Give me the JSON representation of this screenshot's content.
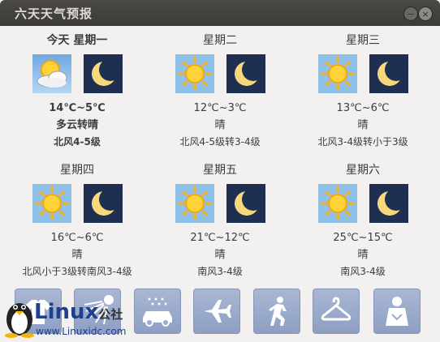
{
  "window": {
    "title": "六天天气预报",
    "minimize_glyph": "−",
    "close_glyph": "×"
  },
  "days": [
    {
      "name": "今天  星期一",
      "temp": "14℃~5℃",
      "condition": "多云转晴",
      "wind": "北风4-5级",
      "day_icon": "partly-cloudy-icon",
      "night_icon": "moon-icon"
    },
    {
      "name": "星期二",
      "temp": "12℃~3℃",
      "condition": "晴",
      "wind": "北风4-5级转3-4级",
      "day_icon": "sun-icon",
      "night_icon": "moon-icon"
    },
    {
      "name": "星期三",
      "temp": "13℃~6℃",
      "condition": "晴",
      "wind": "北风3-4级转小于3级",
      "day_icon": "sun-icon",
      "night_icon": "moon-icon"
    },
    {
      "name": "星期四",
      "temp": "16℃~6℃",
      "condition": "晴",
      "wind": "北风小于3级转南风3-4级",
      "day_icon": "sun-icon",
      "night_icon": "moon-icon"
    },
    {
      "name": "星期五",
      "temp": "21℃~12℃",
      "condition": "晴",
      "wind": "南风3-4级",
      "day_icon": "sun-icon",
      "night_icon": "moon-icon"
    },
    {
      "name": "星期六",
      "temp": "25℃~15℃",
      "condition": "晴",
      "wind": "南风3-4级",
      "day_icon": "sun-icon",
      "night_icon": "moon-icon"
    }
  ],
  "tools": [
    {
      "icon": "clothing-icon"
    },
    {
      "icon": "sunshine-icon"
    },
    {
      "icon": "car-wash-icon"
    },
    {
      "icon": "airplane-icon"
    },
    {
      "icon": "running-icon"
    },
    {
      "icon": "clothes-hanger-icon"
    },
    {
      "icon": "person-icon"
    }
  ],
  "watermark": {
    "brand": "Linux",
    "brand_suffix": "公社",
    "url": "www.Linuxidc.com"
  },
  "colors": {
    "titlebar": "#3c3b37",
    "window_bg": "#f2f1f0",
    "night_sky": "#1f2f4f",
    "day_sky": "#8ec0ea",
    "tool_bg": "#9aabcc"
  }
}
